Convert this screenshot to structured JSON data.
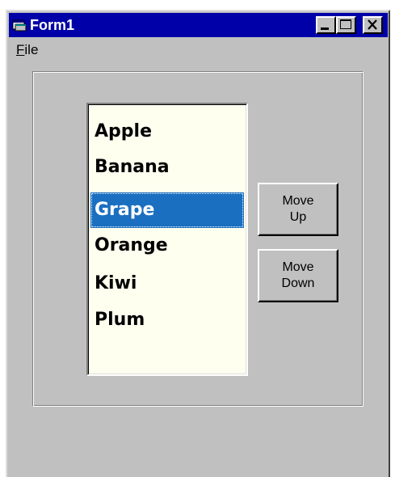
{
  "window": {
    "title": "Form1"
  },
  "menu": {
    "items": [
      {
        "label_first": "F",
        "label_rest": "ile"
      }
    ]
  },
  "listbox": {
    "items": [
      "Apple",
      "Banana",
      "Grape",
      "Orange",
      "Kiwi",
      "Plum"
    ],
    "selected": "Grape"
  },
  "buttons": {
    "move_up": {
      "line1": "Move",
      "line2": "Up"
    },
    "move_down": {
      "line1": "Move",
      "line2": "Down"
    }
  },
  "colors": {
    "titlebar": "#0000a8",
    "face": "#c0c0c0",
    "list_background": "#fffff0",
    "selection": "#1a6fc0"
  },
  "icons": {
    "app": "form-window-icon",
    "minimize": "minimize-icon",
    "maximize": "maximize-icon",
    "close": "close-icon"
  }
}
